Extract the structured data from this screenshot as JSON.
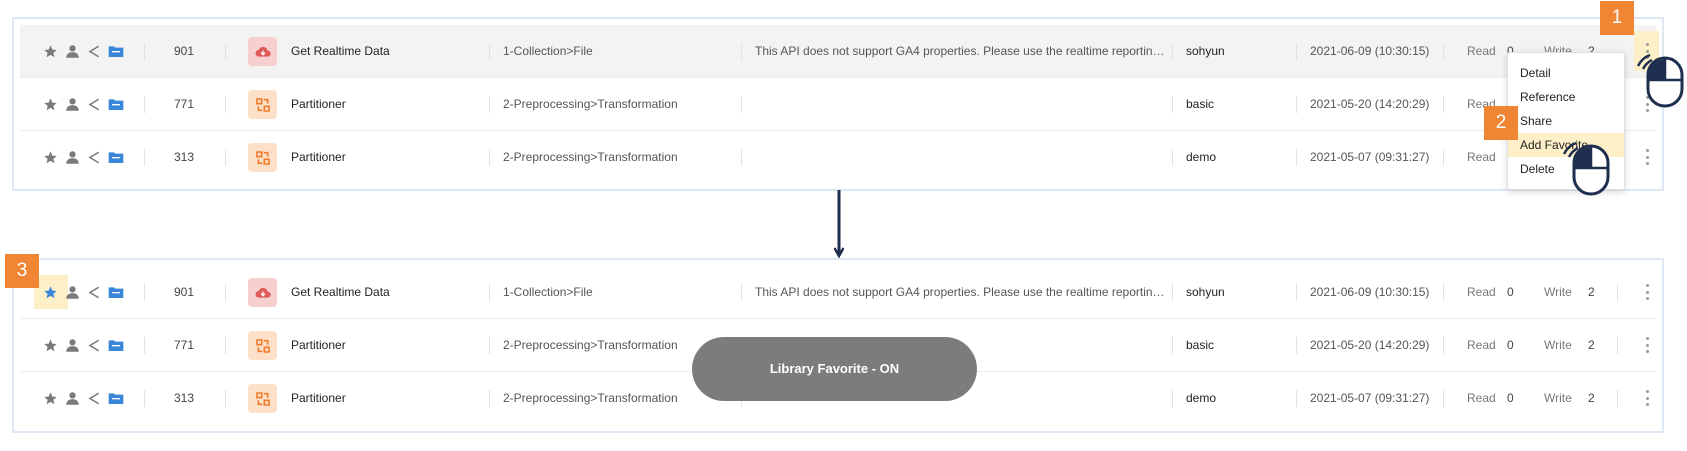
{
  "colors": {
    "accent_blue": "#3a87d9",
    "icon_gray": "#7a7a7a",
    "highlight": "#fdf0c8",
    "badge_orange": "#f08634",
    "toast_bg": "#7c7c7c",
    "arrow_navy": "#1e2e4e"
  },
  "icons": {
    "star": "star-icon",
    "person": "person-icon",
    "share": "share-icon",
    "folder": "folder-icon",
    "cloud": "cloud-download-icon",
    "partition": "partition-icon",
    "kebab": "kebab-menu-icon",
    "mouse": "mouse-icon"
  },
  "top": {
    "rows": [
      {
        "num": "901",
        "name": "Get Realtime Data",
        "path": "1-Collection>File",
        "desc": "This API does not support GA4 properties. Please use the realtime reporting ...",
        "user": "sohyun",
        "date": "2021-06-09 (10:30:15)",
        "read_label": "Read",
        "read": "0",
        "write_label": "Write",
        "write": "2"
      },
      {
        "num": "771",
        "name": "Partitioner",
        "path": "2-Preprocessing>Transformation",
        "desc": "",
        "user": "basic",
        "date": "2021-05-20 (14:20:29)",
        "read_label": "Read",
        "read": "0",
        "write_label": "",
        "write": ""
      },
      {
        "num": "313",
        "name": "Partitioner",
        "path": "2-Preprocessing>Transformation",
        "desc": "",
        "user": "demo",
        "date": "2021-05-07 (09:31:27)",
        "read_label": "Read",
        "read": "0",
        "write_label": "",
        "write": ""
      }
    ],
    "menu": [
      "Detail",
      "Reference",
      "Share",
      "Add Favorite",
      "Delete"
    ]
  },
  "bottom": {
    "rows": [
      {
        "num": "901",
        "name": "Get Realtime Data",
        "path": "1-Collection>File",
        "desc": "This API does not support GA4 properties. Please use the realtime reporting ...",
        "user": "sohyun",
        "date": "2021-06-09 (10:30:15)",
        "read_label": "Read",
        "read": "0",
        "write_label": "Write",
        "write": "2"
      },
      {
        "num": "771",
        "name": "Partitioner",
        "path": "2-Preprocessing>Transformation",
        "desc": "",
        "user": "basic",
        "date": "2021-05-20 (14:20:29)",
        "read_label": "Read",
        "read": "0",
        "write_label": "Write",
        "write": "2"
      },
      {
        "num": "313",
        "name": "Partitioner",
        "path": "2-Preprocessing>Transformation",
        "desc": "",
        "user": "demo",
        "date": "2021-05-07 (09:31:27)",
        "read_label": "Read",
        "read": "0",
        "write_label": "Write",
        "write": "2"
      }
    ],
    "toast": "Library Favorite - ON"
  },
  "badges": {
    "step1": "1",
    "step2": "2",
    "step3": "3"
  }
}
